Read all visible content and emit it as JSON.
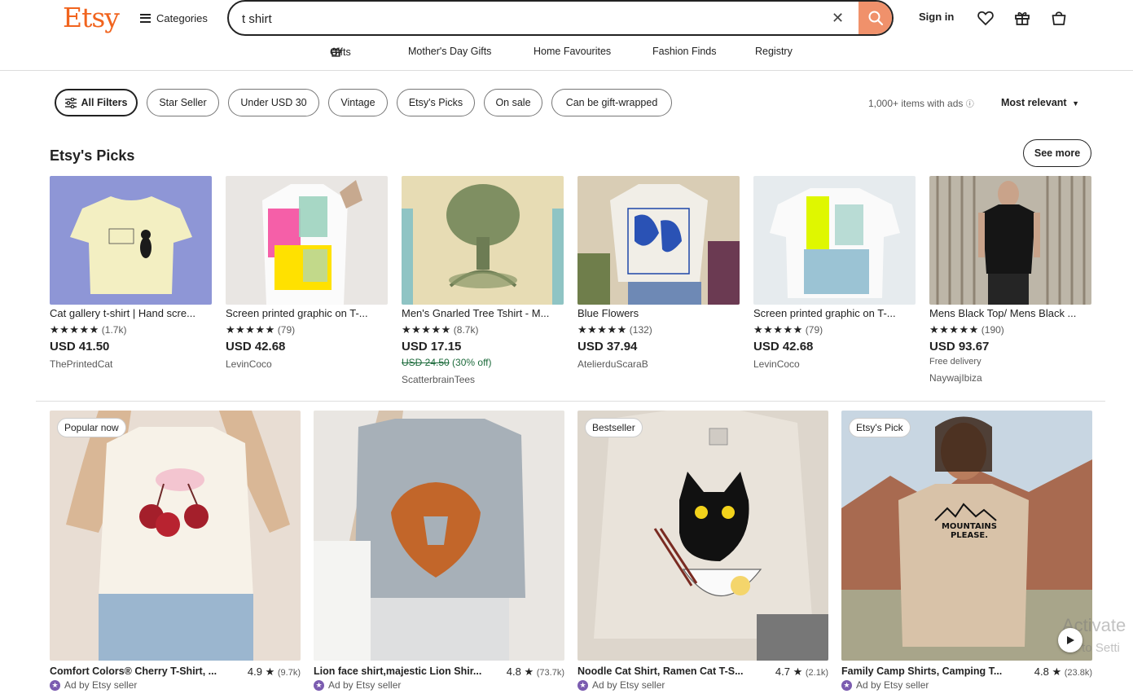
{
  "header": {
    "logo": "Etsy",
    "categories_label": "Categories",
    "search_value": "t shirt",
    "signin_label": "Sign in"
  },
  "topnav": [
    "Gifts",
    "Mother's Day Gifts",
    "Home Favourites",
    "Fashion Finds",
    "Registry"
  ],
  "filters": {
    "all_filters": "All Filters",
    "chips": [
      "Star Seller",
      "Under USD 30",
      "Vintage",
      "Etsy's Picks",
      "On sale",
      "Can be gift-wrapped"
    ],
    "count": "1,000+ items with ads",
    "sort": "Most relevant"
  },
  "picks": {
    "title": "Etsy's Picks",
    "see_more": "See more",
    "items": [
      {
        "title": "Cat gallery t-shirt | Hand scre...",
        "stars": "★★★★★",
        "reviews": "(1.7k)",
        "price": "USD 41.50",
        "shop": "ThePrintedCat"
      },
      {
        "title": "Screen printed graphic on T-...",
        "stars": "★★★★★",
        "reviews": "(79)",
        "price": "USD 42.68",
        "shop": "LevinCoco"
      },
      {
        "title": "Men's Gnarled Tree Tshirt - M...",
        "stars": "★★★★★",
        "reviews": "(8.7k)",
        "price": "USD 17.15",
        "original": "USD 24.50",
        "discount": "(30% off)",
        "shop": "ScatterbrainTees"
      },
      {
        "title": "Blue Flowers",
        "stars": "★★★★★",
        "reviews": "(132)",
        "price": "USD 37.94",
        "shop": "AtelierduScaraB"
      },
      {
        "title": "Screen printed graphic on T-...",
        "stars": "★★★★★",
        "reviews": "(79)",
        "price": "USD 42.68",
        "shop": "LevinCoco"
      },
      {
        "title": "Mens Black Top/ Mens Black ...",
        "stars": "★★★★★",
        "reviews": "(190)",
        "price": "USD 93.67",
        "delivery": "Free delivery",
        "shop": "NaywajIbiza"
      }
    ]
  },
  "listings": [
    {
      "badge": "Popular now",
      "title": "Comfort Colors® Cherry T-Shirt, ...",
      "rating": "4.9",
      "reviews": "(9.7k)",
      "ad": "Ad by Etsy seller"
    },
    {
      "badge": "",
      "title": "Lion face shirt,majestic Lion Shir...",
      "rating": "4.8",
      "reviews": "(73.7k)",
      "ad": "Ad by Etsy seller"
    },
    {
      "badge": "Bestseller",
      "title": "Noodle Cat Shirt, Ramen Cat T-S...",
      "rating": "4.7",
      "reviews": "(2.1k)",
      "ad": "Ad by Etsy seller"
    },
    {
      "badge": "Etsy's Pick",
      "title": "Family Camp Shirts, Camping T...",
      "rating": "4.8",
      "reviews": "(23.8k)",
      "ad": "Ad by Etsy seller"
    }
  ],
  "overlay": {
    "line1": "Activate",
    "line2": "Go to Setti"
  },
  "graphic_text": {
    "mountains": "MOUNTAINS PLEASE."
  },
  "colors": {
    "brand": "#f1641e",
    "search_button": "#f0916b",
    "sale_green": "#1d6b3c",
    "ad_purple": "#7b5cb0"
  }
}
